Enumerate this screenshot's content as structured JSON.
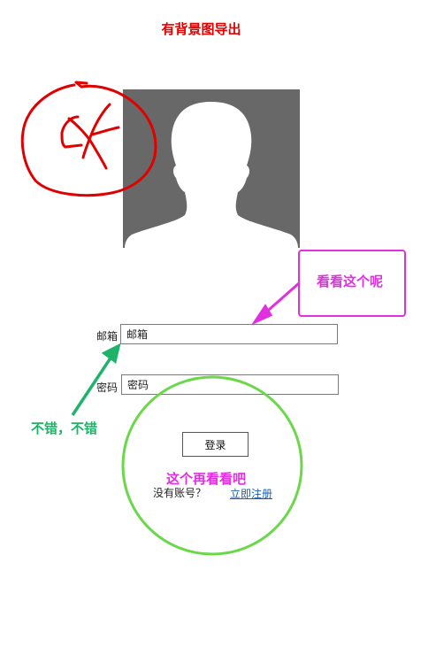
{
  "page": {
    "title": "有背景图导出"
  },
  "form": {
    "email_label": "邮箱",
    "email_value": "邮箱",
    "password_label": "密码",
    "password_value": "密码",
    "login_button": "登录",
    "no_account_text": "没有账号？",
    "register_link": "立即注册"
  },
  "annotations": {
    "callout_text": "看看这个呢",
    "green_note": "不错，不错",
    "circle_note": "这个再看看吧",
    "colors": {
      "red": "#e00000",
      "magenta": "#e030e0",
      "green_text": "#1fb36a",
      "green_circle": "#6ad84a"
    }
  },
  "icons": {
    "avatar": "person-silhouette-icon"
  }
}
